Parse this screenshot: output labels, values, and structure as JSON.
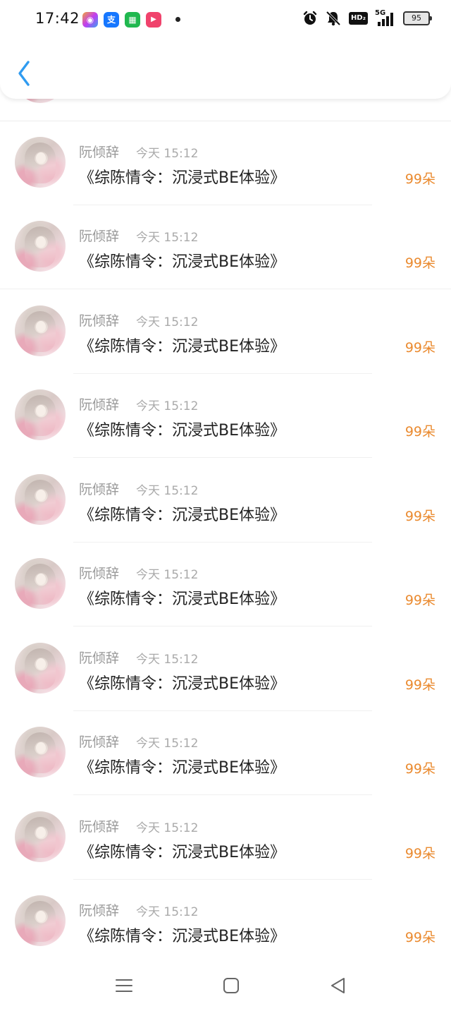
{
  "status_bar": {
    "time": "17:42",
    "apps": [
      {
        "icon": "app-icon-multicolor",
        "glyph": "◉",
        "color": "#9b57f0"
      },
      {
        "icon": "alipay-icon",
        "glyph": "支",
        "color": "#1677ff"
      },
      {
        "icon": "app-icon-green",
        "glyph": "▦",
        "color": "#20b84f"
      },
      {
        "icon": "video-play-icon",
        "glyph": "▶",
        "color": "#f0436c"
      }
    ],
    "hd": "HD₂",
    "network": "5G",
    "battery": "95"
  },
  "list": {
    "items": [
      {
        "name": "阮倾辞",
        "time": "今天 15:12",
        "title": "《综陈情令：沉浸式BE体验》",
        "amount": "99朵"
      },
      {
        "name": "阮倾辞",
        "time": "今天 15:12",
        "title": "《综陈情令：沉浸式BE体验》",
        "amount": "99朵"
      },
      {
        "name": "阮倾辞",
        "time": "今天 15:12",
        "title": "《综陈情令：沉浸式BE体验》",
        "amount": "99朵"
      },
      {
        "name": "阮倾辞",
        "time": "今天 15:12",
        "title": "《综陈情令：沉浸式BE体验》",
        "amount": "99朵"
      },
      {
        "name": "阮倾辞",
        "time": "今天 15:12",
        "title": "《综陈情令：沉浸式BE体验》",
        "amount": "99朵"
      },
      {
        "name": "阮倾辞",
        "time": "今天 15:12",
        "title": "《综陈情令：沉浸式BE体验》",
        "amount": "99朵"
      },
      {
        "name": "阮倾辞",
        "time": "今天 15:12",
        "title": "《综陈情令：沉浸式BE体验》",
        "amount": "99朵"
      },
      {
        "name": "阮倾辞",
        "time": "今天 15:12",
        "title": "《综陈情令：沉浸式BE体验》",
        "amount": "99朵"
      },
      {
        "name": "阮倾辞",
        "time": "今天 15:12",
        "title": "《综陈情令：沉浸式BE体验》",
        "amount": "99朵"
      },
      {
        "name": "阮倾辞",
        "time": "今天 15:12",
        "title": "《综陈情令：沉浸式BE体验》",
        "amount": "99朵"
      }
    ]
  },
  "colors": {
    "accent_back": "#2f9bf0",
    "amount": "#ea8a2f"
  }
}
